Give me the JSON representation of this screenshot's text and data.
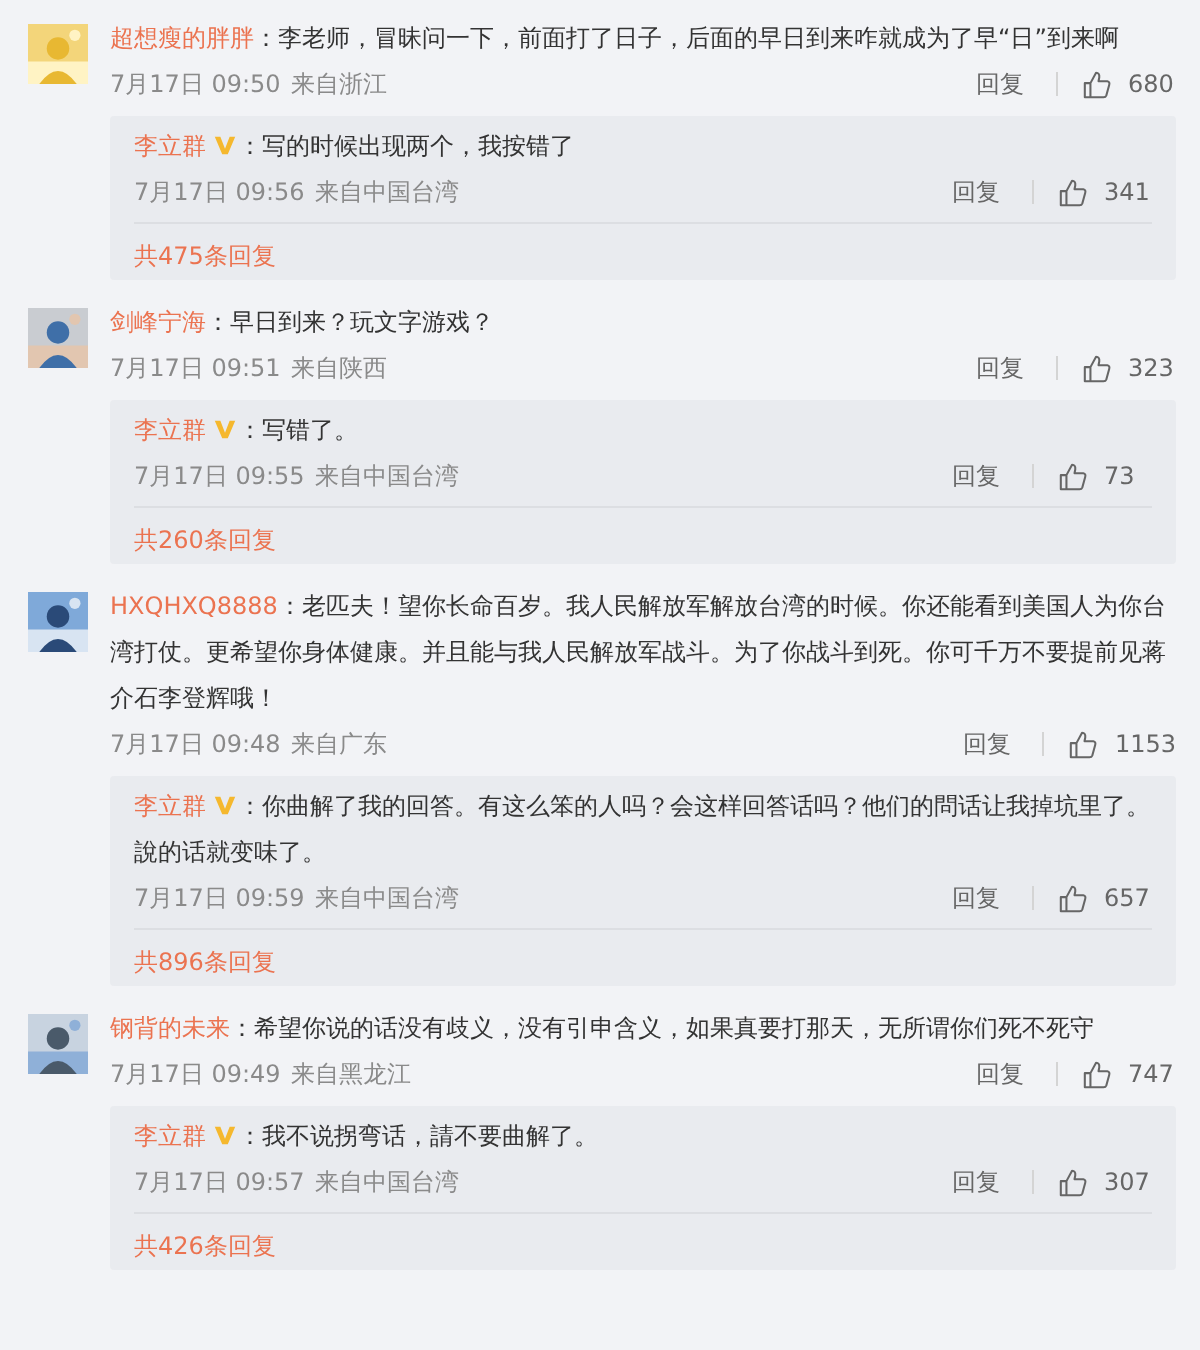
{
  "comments": [
    {
      "username": "超想瘦的胖胖",
      "separator": "：",
      "text": "李老师，冒昧问一下，前面打了日子，后面的早日到来咋就成为了早“日”到来啊",
      "date": "7月17日 09:50",
      "location": "来自浙江",
      "reply_label": "回复",
      "likes": "680",
      "replies": [
        {
          "username": "李立群",
          "verified": true,
          "separator": "：",
          "text": "写的时候出现两个，我按错了",
          "date": "7月17日 09:56",
          "location": "来自中国台湾",
          "reply_label": "回复",
          "likes": "341"
        }
      ],
      "reply_count": "共475条回复"
    },
    {
      "username": "剑峰宁海",
      "separator": "：",
      "text": "早日到来？玩文字游戏？",
      "date": "7月17日 09:51",
      "location": "来自陕西",
      "reply_label": "回复",
      "likes": "323",
      "replies": [
        {
          "username": "李立群",
          "verified": true,
          "separator": "：",
          "text": "写错了。",
          "date": "7月17日 09:55",
          "location": "来自中国台湾",
          "reply_label": "回复",
          "likes": "73"
        }
      ],
      "reply_count": "共260条回复"
    },
    {
      "username": "HXQHXQ8888",
      "separator": "：",
      "text": "老匹夫！望你长命百岁。我人民解放军解放台湾的时候。你还能看到美国人为你台湾打仗。更希望你身体健康。并且能与我人民解放军战斗。为了你战斗到死。你可千万不要提前见蒋介石李登辉哦！",
      "date": "7月17日 09:48",
      "location": "来自广东",
      "reply_label": "回复",
      "likes": "1153",
      "replies": [
        {
          "username": "李立群",
          "verified": true,
          "separator": "：",
          "text": "你曲解了我的回答。有这么笨的人吗？会这样回答话吗？他们的問话让我掉坑里了。說的话就变味了。",
          "date": "7月17日 09:59",
          "location": "来自中国台湾",
          "reply_label": "回复",
          "likes": "657"
        }
      ],
      "reply_count": "共896条回复"
    },
    {
      "username": "钢背的未来",
      "separator": "：",
      "text": "希望你说的话没有歧义，没有引申含义，如果真要打那天，无所谓你们死不死守",
      "date": "7月17日 09:49",
      "location": "来自黑龙江",
      "reply_label": "回复",
      "likes": "747",
      "replies": [
        {
          "username": "李立群",
          "verified": true,
          "separator": "：",
          "text": "我不说拐弯话，請不要曲解了。",
          "date": "7月17日 09:57",
          "location": "来自中国台湾",
          "reply_label": "回复",
          "likes": "307"
        }
      ],
      "reply_count": "共426条回复"
    }
  ]
}
